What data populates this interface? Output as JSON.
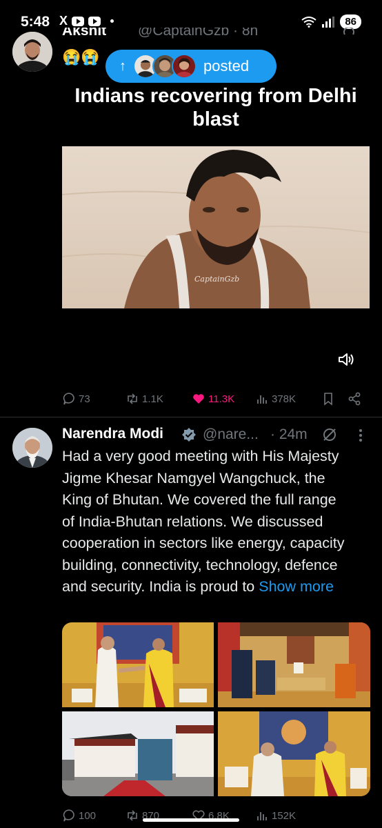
{
  "status_bar": {
    "time": "5:48",
    "x_logo": "X",
    "battery": "86"
  },
  "post1": {
    "author_name": "Akshit",
    "handle": "@CaptainGzb · 8h",
    "emoji": "😭😭",
    "caption": "Indians recovering from Delhi blast",
    "image_watermark": "CaptainGzb",
    "stats": {
      "replies": "73",
      "reposts": "1.1K",
      "likes": "11.3K",
      "views": "378K"
    }
  },
  "posted_pill": {
    "label": "posted",
    "arrow": "↑"
  },
  "post2": {
    "author_name": "Narendra Modi",
    "handle": "@nare...",
    "time": "· 24m",
    "text": "Had a very good meeting with His Majesty Jigme Khesar Namgyel Wangchuck, the King of Bhutan. We covered the full range of India-Bhutan relations. We discussed cooperation in sectors like energy, capacity building, connectivity, technology, defence and security. India is proud to",
    "show_more": "Show more",
    "stats": {
      "replies": "100",
      "reposts": "870",
      "likes": "6.8K",
      "views": "152K"
    }
  },
  "colors": {
    "background": "#000000",
    "accent": "#1d9bf0",
    "like": "#f91880",
    "muted": "#71767b",
    "text": "#e7e9ea"
  }
}
